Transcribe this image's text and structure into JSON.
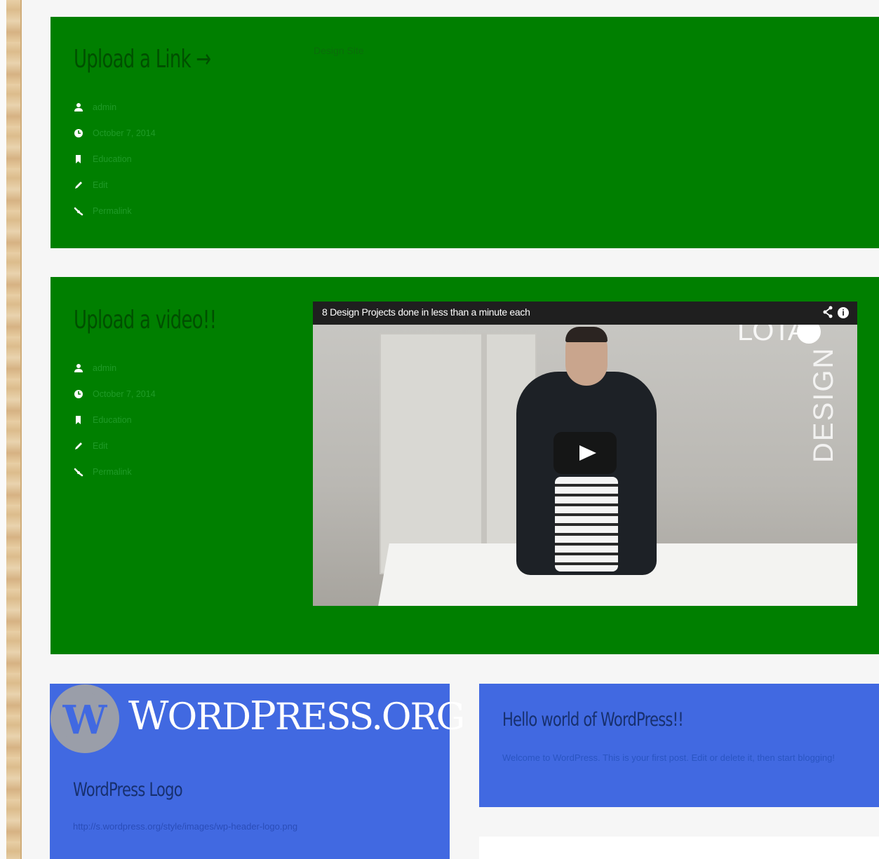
{
  "posts": [
    {
      "title": "Upload a Link →",
      "side_text": "Design Site",
      "meta": {
        "author": "admin",
        "date": "October 7, 2014",
        "category": "Education",
        "edit": "Edit",
        "permalink": "Permalink"
      }
    },
    {
      "title": "Upload a video!!",
      "meta": {
        "author": "admin",
        "date": "October 7, 2014",
        "category": "Education",
        "edit": "Edit",
        "permalink": "Permalink"
      },
      "video": {
        "title": "8 Design Projects done in less than a minute each",
        "watermark_top": "LOTA",
        "watermark_side": "DESIGN"
      }
    },
    {
      "logo": {
        "big1": "W",
        "rest1": "ORD",
        "big2": "P",
        "rest2": "RESS",
        "suffix": ".ORG"
      },
      "title": "WordPress Logo",
      "url": "http://s.wordpress.org/style/images/wp-header-logo.png"
    },
    {
      "title": "Hello world of WordPress!!",
      "excerpt": "Welcome to WordPress. This is your first post. Edit or delete it, then start blogging!"
    }
  ],
  "icons": [
    "user-icon",
    "clock-icon",
    "bookmark-icon",
    "pencil-icon",
    "link-icon",
    "share-icon",
    "info-icon",
    "play-icon"
  ],
  "colors": {
    "green_card": "#007f00",
    "blue_card": "#4169e1",
    "background": "#f6f6f6"
  }
}
